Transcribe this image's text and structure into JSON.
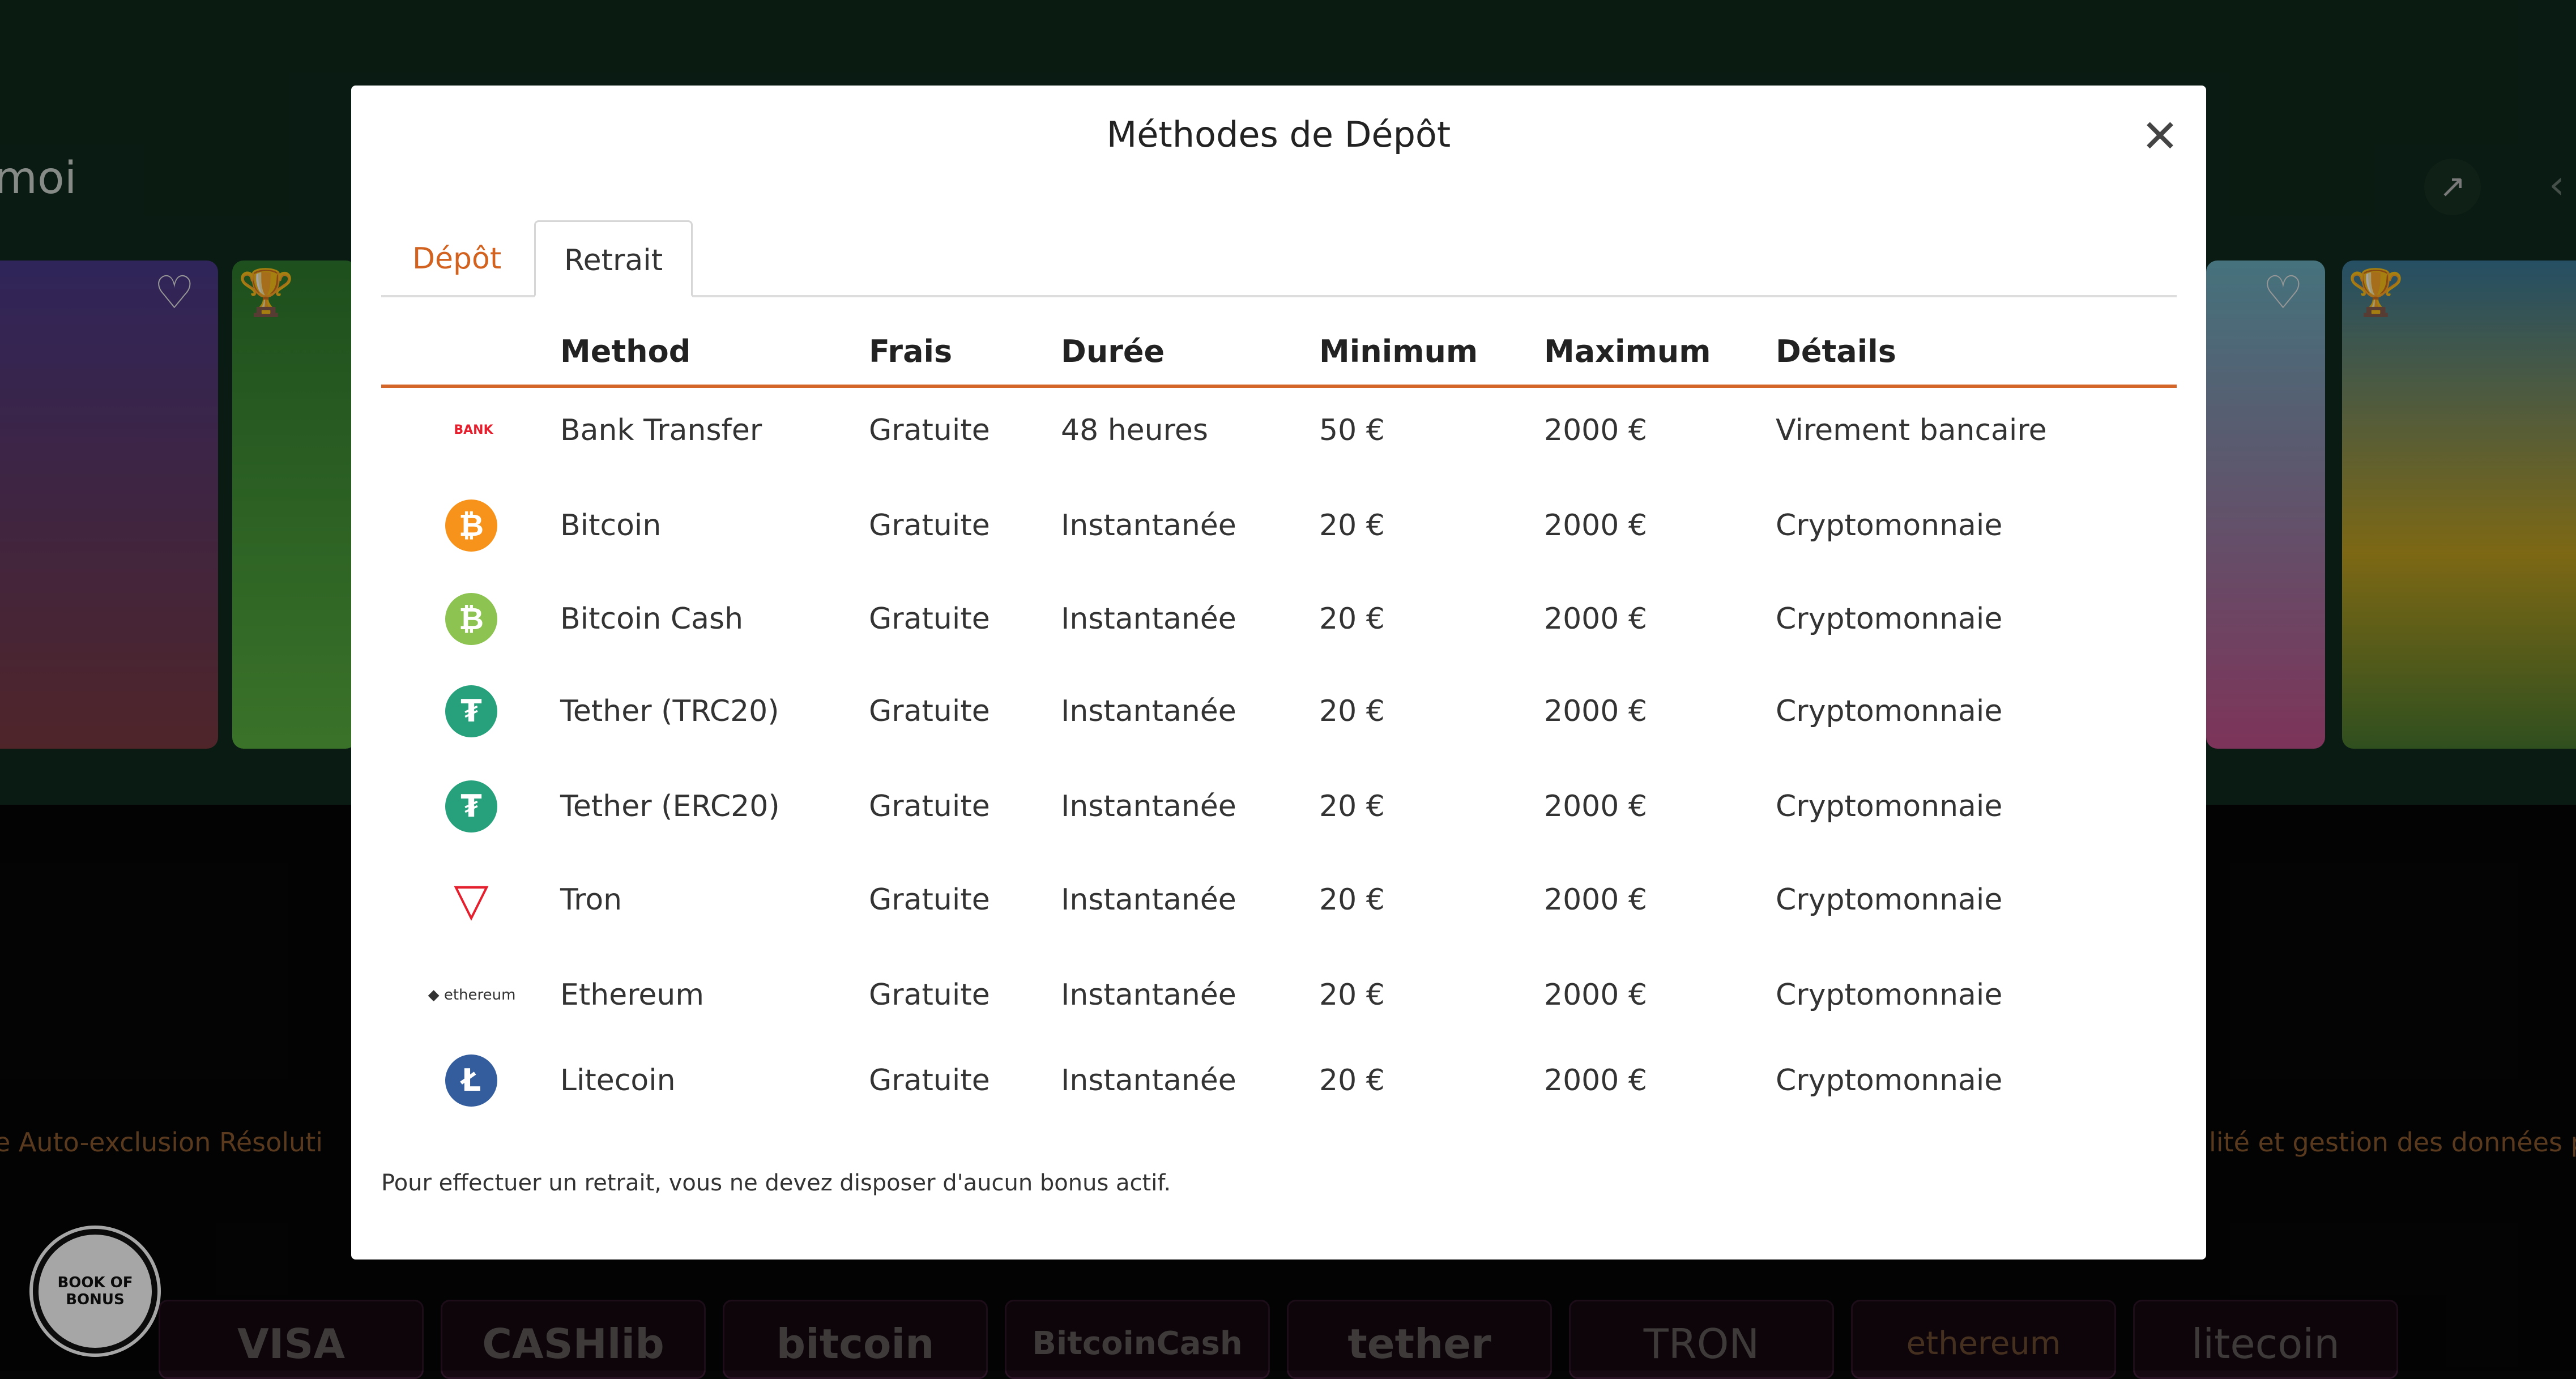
{
  "background": {
    "section_title": "moi",
    "footer_links_left": "e  Auto-exclusion  Résoluti",
    "footer_links_right": "lité et gestion des données p",
    "badge_text": "BOOK OF BONUS",
    "payment_logos": [
      "VISA",
      "CASHlib",
      "bitcoin",
      "BitcoinCash",
      "tether",
      "TRON",
      "ethereum",
      "litecoin"
    ]
  },
  "modal": {
    "title": "Méthodes de Dépôt",
    "close_icon": "close-icon",
    "tabs": [
      {
        "label": "Dépôt",
        "active": false
      },
      {
        "label": "Retrait",
        "active": true
      }
    ],
    "columns": [
      "Method",
      "Frais",
      "Durée",
      "Minimum",
      "Maximum",
      "Détails"
    ],
    "rows": [
      {
        "icon": "bank-transfer-logo",
        "method": "Bank Transfer",
        "fee": "Gratuite",
        "duration": "48 heures",
        "min": "50 €",
        "max": "2000 €",
        "details": "Virement bancaire"
      },
      {
        "icon": "bitcoin-icon",
        "method": "Bitcoin",
        "fee": "Gratuite",
        "duration": "Instantanée",
        "min": "20 €",
        "max": "2000 €",
        "details": "Cryptomonnaie"
      },
      {
        "icon": "bitcoin-cash-icon",
        "method": "Bitcoin Cash",
        "fee": "Gratuite",
        "duration": "Instantanée",
        "min": "20 €",
        "max": "2000 €",
        "details": "Cryptomonnaie"
      },
      {
        "icon": "tether-icon",
        "method": "Tether (TRC20)",
        "fee": "Gratuite",
        "duration": "Instantanée",
        "min": "20 €",
        "max": "2000 €",
        "details": "Cryptomonnaie"
      },
      {
        "icon": "tether-icon",
        "method": "Tether (ERC20)",
        "fee": "Gratuite",
        "duration": "Instantanée",
        "min": "20 €",
        "max": "2000 €",
        "details": "Cryptomonnaie"
      },
      {
        "icon": "tron-icon",
        "method": "Tron",
        "fee": "Gratuite",
        "duration": "Instantanée",
        "min": "20 €",
        "max": "2000 €",
        "details": "Cryptomonnaie"
      },
      {
        "icon": "ethereum-logo",
        "method": "Ethereum",
        "fee": "Gratuite",
        "duration": "Instantanée",
        "min": "20 €",
        "max": "2000 €",
        "details": "Cryptomonnaie"
      },
      {
        "icon": "litecoin-icon",
        "method": "Litecoin",
        "fee": "Gratuite",
        "duration": "Instantanée",
        "min": "20 €",
        "max": "2000 €",
        "details": "Cryptomonnaie"
      }
    ],
    "note": "Pour effectuer un retrait, vous ne devez disposer d'aucun bonus actif.",
    "colors": {
      "accent": "#d4662a",
      "bitcoin": "#f7931a",
      "bitcoin_cash": "#8dc351",
      "tether": "#26a17b",
      "tron": "#e5202e",
      "litecoin": "#345d9d"
    }
  }
}
